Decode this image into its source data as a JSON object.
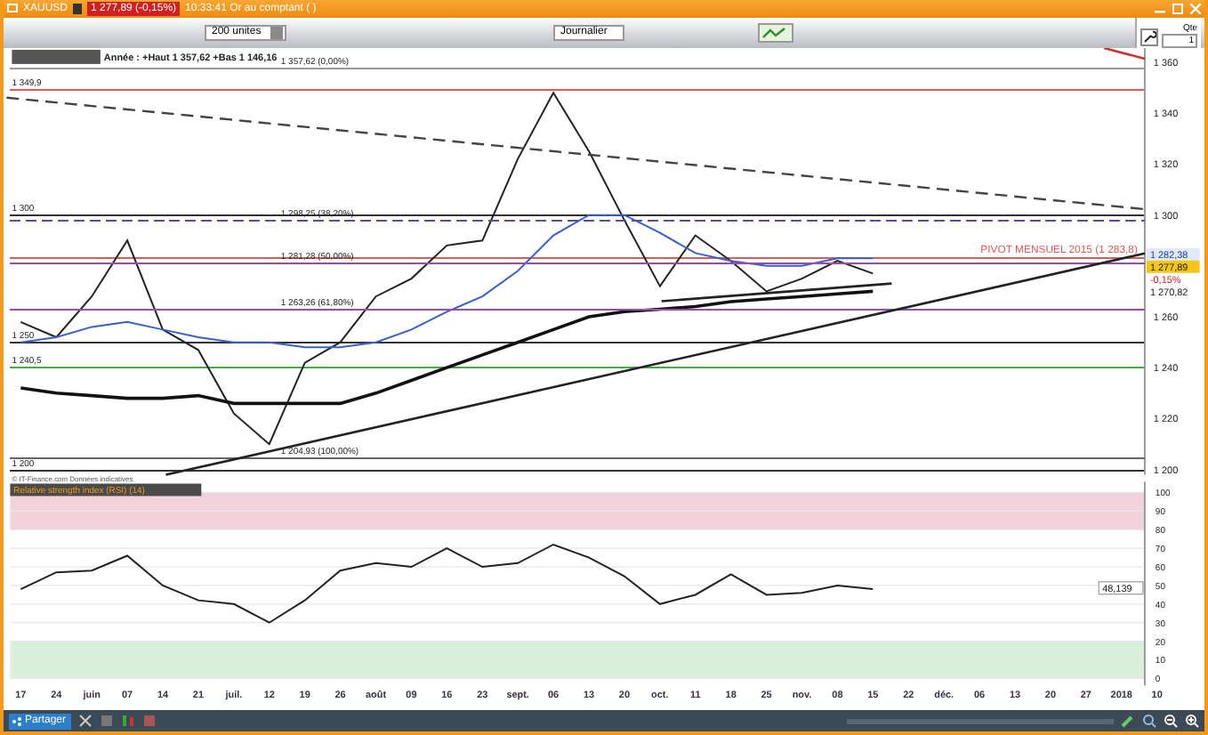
{
  "window": {
    "symbol": "XAUUSD",
    "price_badge": "1 277,89 (-0,15%)",
    "subtitle": "10:33:41 Or au comptant ( )"
  },
  "toolbar": {
    "units": "200 unites",
    "period": "Journalier",
    "quantity_label": "Qte",
    "quantity": "1"
  },
  "price_panel": {
    "legend": "Année : +Haut 1 357,62 +Bas 1 146,16",
    "source": "© IT-Finance.com Données indicatives",
    "pivot_label": "PIVOT MENSUEL 2015 (1 283,8)",
    "chart_data": {
      "type": "line",
      "ylim": [
        1198,
        1366
      ],
      "yticks": [
        {
          "value": 1360,
          "label": "1 360"
        },
        {
          "value": 1340,
          "label": "1 340"
        },
        {
          "value": 1320,
          "label": "1 320"
        },
        {
          "value": 1300,
          "label": "1 300"
        },
        {
          "value": 1260,
          "label": "1 260"
        },
        {
          "value": 1240,
          "label": "1 240"
        },
        {
          "value": 1220,
          "label": "1 220"
        },
        {
          "value": 1200,
          "label": "1 200"
        }
      ],
      "series": [
        {
          "color": "#222222",
          "values": [
            1258,
            1252,
            1268,
            1290,
            1255,
            1247,
            1222,
            1210,
            1242,
            1250,
            1268,
            1275,
            1288,
            1290,
            1322,
            1348,
            1325,
            1298,
            1272,
            1292,
            1282,
            1270,
            1275,
            1282,
            1277,
            null,
            null,
            null,
            null,
            null,
            null,
            null,
            null
          ]
        },
        {
          "color": "#3a5fcd",
          "values": [
            1250,
            1252,
            1256,
            1258,
            1255,
            1252,
            1250,
            1250,
            1248,
            1248,
            1250,
            1255,
            1262,
            1268,
            1278,
            1292,
            1300,
            1300,
            1293,
            1285,
            1282,
            1280,
            1280,
            1283,
            1283,
            null,
            null,
            null,
            null,
            null,
            null,
            null,
            null
          ]
        },
        {
          "color": "#111111",
          "values": [
            1232,
            1230,
            1229,
            1228,
            1228,
            1229,
            1226,
            1226,
            1226,
            1226,
            1230,
            1235,
            1240,
            1245,
            1250,
            1255,
            1260,
            1262,
            1263,
            1264,
            1266,
            1267,
            1268,
            1269,
            1270,
            null,
            null,
            null,
            null,
            null,
            null,
            null,
            null
          ]
        }
      ],
      "ref_lines": [
        {
          "axis": "y",
          "value": 1349.9,
          "label": "1 349,9",
          "color": "#e05a5a"
        },
        {
          "axis": "y",
          "value": 1300,
          "label": "1 300",
          "color": "#333333"
        },
        {
          "axis": "y",
          "value": 1283.8,
          "color": "#e05a5a"
        },
        {
          "axis": "y",
          "value": 1250,
          "label": "1 250",
          "color": "#333333"
        },
        {
          "axis": "y",
          "value": 1240.5,
          "label": "1 240,5",
          "color": "#4aaa4a"
        },
        {
          "axis": "y",
          "value": 1200,
          "label": "1 200",
          "color": "#333333"
        }
      ]
    },
    "fibonacci_levels": [
      "1 357,62 (0,00%)",
      "1 298,25 (38,20%)",
      "1 281,28 (50,00%)",
      "1 263,26 (61,80%)",
      "1 204,93 (100,00%)"
    ],
    "axis_badges": [
      {
        "text": "1 282,38",
        "kind": "blue"
      },
      {
        "text": "1 277,89",
        "kind": "current"
      },
      {
        "text": "-0,15%",
        "kind": "change"
      },
      {
        "text": "1 270,82",
        "kind": "plain"
      }
    ]
  },
  "rsi_panel": {
    "title": "Relative strength index (RSI) (14)",
    "reading": "48,139",
    "chart_data": {
      "type": "line",
      "ylim": [
        0,
        100
      ],
      "grid": true,
      "yticks": [
        0,
        10,
        20,
        30,
        40,
        50,
        60,
        70,
        80,
        90,
        100
      ],
      "categories": [
        "17",
        "24",
        "juin",
        "07",
        "14",
        "21",
        "juil.",
        "12",
        "19",
        "26",
        "août",
        "09",
        "16",
        "23",
        "sept.",
        "06",
        "13",
        "20",
        "oct.",
        "11",
        "18",
        "25",
        "nov.",
        "08",
        "15",
        "22",
        "déc.",
        "06",
        "13",
        "20",
        "27",
        "2018",
        "10"
      ],
      "series": [
        {
          "color": "#222222",
          "values": [
            48,
            57,
            58,
            66,
            50,
            42,
            40,
            30,
            42,
            58,
            62,
            60,
            70,
            60,
            62,
            72,
            65,
            55,
            40,
            45,
            56,
            45,
            46,
            50,
            48,
            null,
            null,
            null,
            null,
            null,
            null,
            null,
            null
          ]
        }
      ],
      "bands": [
        {
          "axis": "y",
          "from": 80,
          "to": 100,
          "color": "#f2d3dc"
        },
        {
          "axis": "y",
          "from": 0,
          "to": 20,
          "color": "#d9f0da"
        }
      ]
    }
  },
  "bottom_bar": {
    "share_button": "Partager"
  }
}
